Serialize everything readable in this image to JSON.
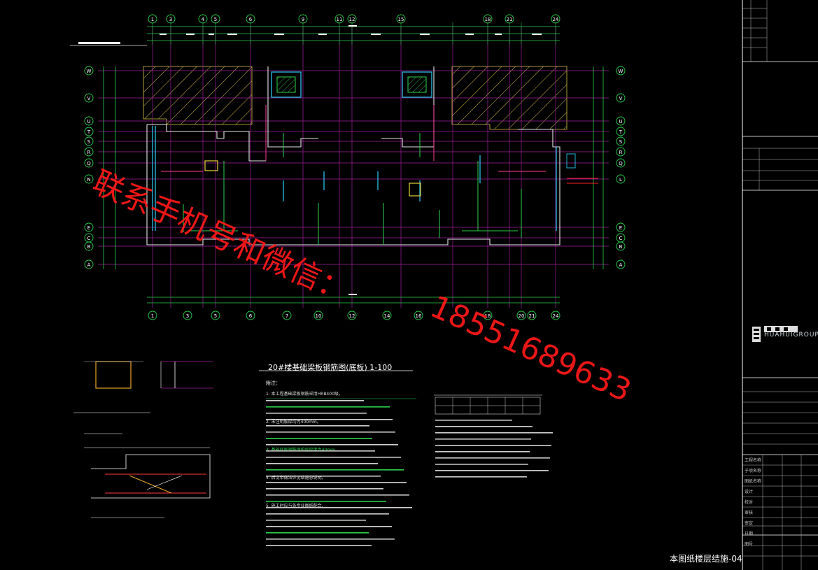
{
  "drawing": {
    "plan_title": "20#楼基础梁板钢筋图(底板)  1-100",
    "sheet_number": "本图纸楼层结施-04",
    "watermark_line1": "联系手机号和微信：",
    "watermark_line2": "18551689633"
  },
  "axes": {
    "top": [
      "1",
      "3",
      "4",
      "5",
      "6",
      "9",
      "11",
      "12",
      "15",
      "18",
      "21",
      "24"
    ],
    "bottom": [
      "1",
      "3",
      "5",
      "6",
      "7",
      "10",
      "12",
      "14",
      "16",
      "18",
      "20",
      "21",
      "24"
    ],
    "left": [
      "W",
      "V",
      "U",
      "T",
      "S",
      "R",
      "Q",
      "N",
      "E",
      "C",
      "B",
      "A"
    ],
    "right": [
      "W",
      "V",
      "U",
      "T",
      "S",
      "R",
      "Q",
      "L",
      "E",
      "C",
      "B",
      "A"
    ]
  },
  "notes": {
    "heading": "附注：",
    "items": [
      "1. 本工程基础梁板钢筋采用HRB400级。",
      "2. 未注明板厚均为400mm。",
      "3. 基础底板钢筋保护层厚度为40mm。",
      "4. 后浇带做法详见结施总说明。",
      "5. 施工时应与各专业图纸配合。"
    ]
  },
  "titleblock": {
    "company": "HUAHUIGROUP",
    "rows": [
      "工程名称",
      "子项名称",
      "图纸名称",
      "设计",
      "校对",
      "审核",
      "审定",
      "日期",
      "图号"
    ]
  }
}
